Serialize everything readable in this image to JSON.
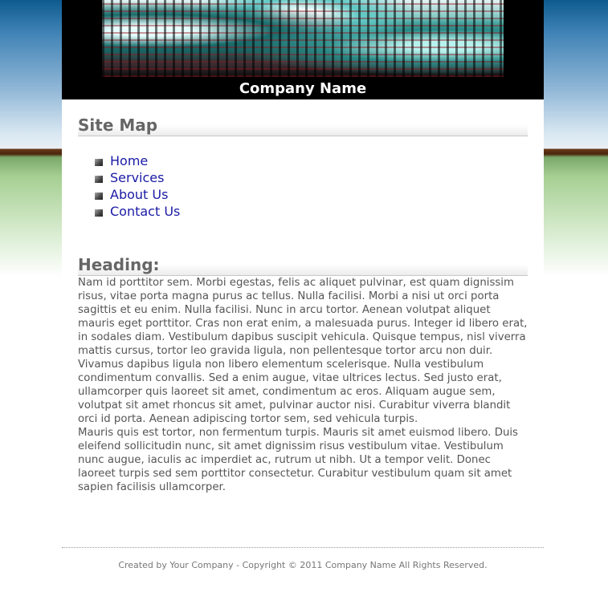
{
  "header": {
    "company_name": "Company Name"
  },
  "sitemap": {
    "title": "Site Map",
    "links": [
      "Home",
      "Services",
      "About Us",
      "Contact Us"
    ]
  },
  "article": {
    "heading": "Heading:",
    "p1": "Nam id porttitor sem. Morbi egestas, felis ac aliquet pulvinar, est quam dignissim risus, vitae porta magna purus ac tellus. Nulla facilisi. Morbi a nisi ut orci porta sagittis et eu enim. Nulla facilisi. Nunc in arcu tortor. Aenean volutpat aliquet mauris eget porttitor. Cras non erat enim, a malesuada purus. Integer id libero erat, in sodales diam. Vestibulum dapibus suscipit vehicula. Quisque tempus, nisl viverra mattis cursus, tortor leo gravida ligula, non pellentesque tortor arcu non duir.",
    "p2": "Vivamus dapibus ligula non libero elementum scelerisque. Nulla vestibulum condimentum convallis. Sed a enim augue, vitae ultrices lectus. Sed justo erat, ullamcorper quis laoreet sit amet, condimentum ac eros. Aliquam augue sem, volutpat sit amet rhoncus sit amet, pulvinar auctor nisi. Curabitur viverra blandit orci id porta. Aenean adipiscing tortor sem, sed vehicula turpis.",
    "p3": "Mauris quis est tortor, non fermentum turpis. Mauris sit amet euismod libero. Duis eleifend sollicitudin nunc, sit amet dignissim risus vestibulum vitae. Vestibulum nunc augue, iaculis ac imperdiet ac, rutrum ut nibh. Ut a tempor velit. Donec laoreet turpis sed sem porttitor consectetur. Curabitur vestibulum quam sit amet sapien facilisis ullamcorper."
  },
  "footer": {
    "text": "Created by Your Company - Copyright © 2011 Company Name All Rights Reserved."
  },
  "colors": {
    "link": "#1a1aa6",
    "heading": "#666666",
    "header_bg": "#000000"
  }
}
